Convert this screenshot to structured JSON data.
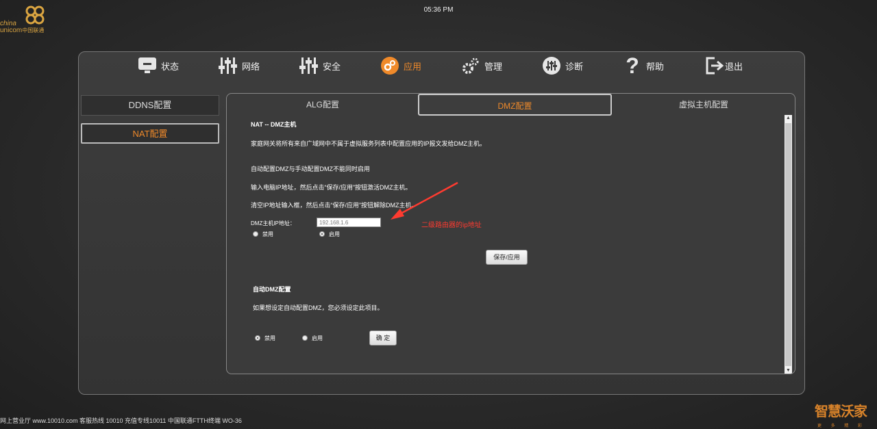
{
  "header": {
    "clock": "05:36 PM",
    "logo_line1": "china",
    "logo_line2": "unicom",
    "logo_cn": "中国联通"
  },
  "nav": [
    {
      "label": "状态",
      "icon": "monitor-icon"
    },
    {
      "label": "网络",
      "icon": "sliders-icon"
    },
    {
      "label": "安全",
      "icon": "sliders-icon"
    },
    {
      "label": "应用",
      "icon": "gear-circle-icon",
      "active": true
    },
    {
      "label": "管理",
      "icon": "gears-icon"
    },
    {
      "label": "诊断",
      "icon": "diagnose-icon"
    },
    {
      "label": "帮助",
      "icon": "question-icon"
    },
    {
      "label": "退出",
      "icon": "exit-icon"
    }
  ],
  "sidebar": [
    {
      "label": "DDNS配置"
    },
    {
      "label": "NAT配置",
      "active": true
    }
  ],
  "tabs": [
    {
      "label": "ALG配置"
    },
    {
      "label": "DMZ配置",
      "active": true
    },
    {
      "label": "虚拟主机配置"
    }
  ],
  "dmz": {
    "heading": "NAT -- DMZ主机",
    "desc": "家庭网关将所有来自广域网中不属于虚拟服务列表中配置应用的IP报文发给DMZ主机。",
    "note1": "自动配置DMZ与手动配置DMZ不能同时启用",
    "note2": "输入电脑IP地址，然后点击“保存/应用”按钮激活DMZ主机。",
    "note3": "清空IP地址输入框，然后点击“保存/应用”按钮解除DMZ主机。",
    "ip_label": "DMZ主机IP地址：",
    "ip_value": "192.168.1.6",
    "disable_label": "禁用",
    "enable_label": "启用",
    "save_label": "保存/应用"
  },
  "auto_dmz": {
    "heading": "自动DMZ配置",
    "desc": "如果想设定自动配置DMZ，您必须设定此项目。",
    "disable_label": "禁用",
    "enable_label": "启用",
    "ok_label": "确 定"
  },
  "annotation": {
    "text": "二级路由器的ip地址",
    "color": "#ff3b30"
  },
  "footer": {
    "text": "网上营业厅 www.10010.com 客服热线 10010 充值专线10011 中国联通FTTH终端 WO-36",
    "brand": "智慧沃家",
    "brand_sub": "更 多 精 彩 家"
  }
}
